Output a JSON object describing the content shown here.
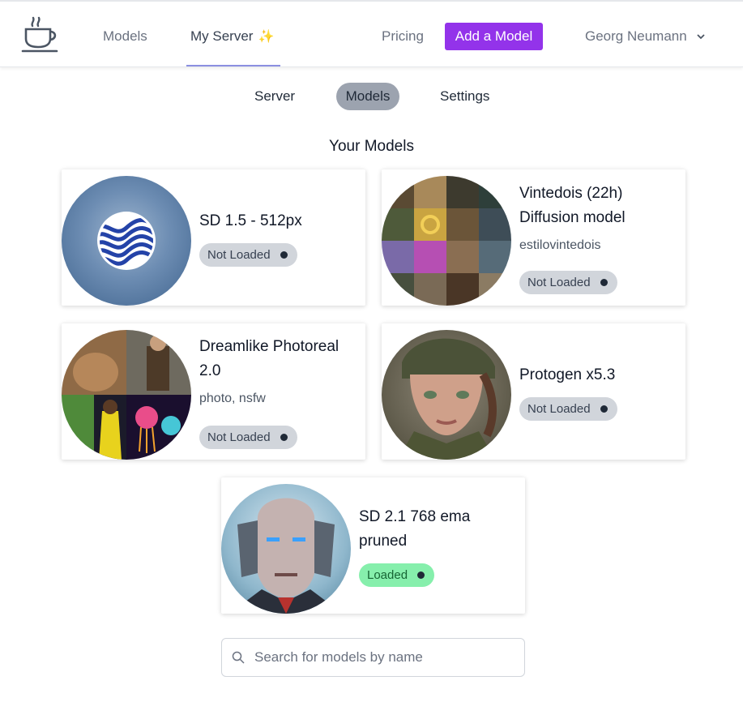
{
  "nav": {
    "links": [
      "Models",
      "My Server",
      "Pricing"
    ],
    "spark_glyph": "✨",
    "add_model": "Add a Model",
    "user_name": "Georg Neumann"
  },
  "colors": {
    "accent": "#9333ea",
    "underline": "#8b8fe0",
    "active_tab": "#9ca3af",
    "loaded_badge": "#86efac",
    "not_loaded_badge": "#d1d5db"
  },
  "tabs": [
    "Server",
    "Models",
    "Settings"
  ],
  "active_tab": "Models",
  "section_title": "Your Models",
  "models": [
    {
      "title": "SD 1.5 - 512px",
      "tags": "",
      "status": "Not Loaded",
      "thumb_icon": "wave-logo-icon"
    },
    {
      "title": "Vintedois (22h) Diffusion model",
      "tags": "estilovintedois",
      "status": "Not Loaded",
      "thumb_icon": "collage-thumbnail"
    },
    {
      "title": "Dreamlike Photoreal 2.0",
      "tags": "photo, nsfw",
      "status": "Not Loaded",
      "thumb_icon": "collage-thumbnail"
    },
    {
      "title": "Protogen x5.3",
      "tags": "",
      "status": "Not Loaded",
      "thumb_icon": "portrait-thumbnail"
    },
    {
      "title": "SD 2.1 768 ema pruned",
      "tags": "",
      "status": "Loaded",
      "thumb_icon": "portrait-thumbnail"
    }
  ],
  "search": {
    "placeholder": "Search for models by name",
    "value": ""
  }
}
